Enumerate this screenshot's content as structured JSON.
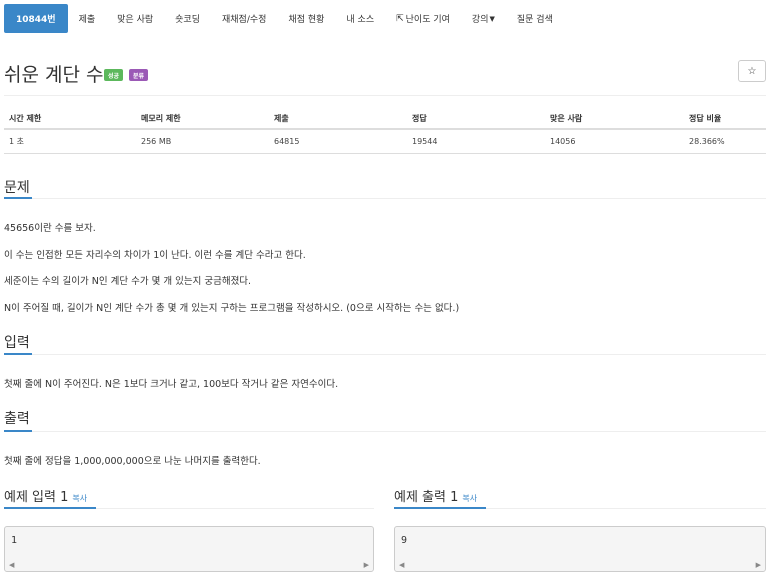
{
  "nav": {
    "tabs": [
      {
        "label": "10844번",
        "active": true
      },
      {
        "label": "제출"
      },
      {
        "label": "맞은 사람"
      },
      {
        "label": "숏코딩"
      },
      {
        "label": "재채점/수정"
      },
      {
        "label": "채점 현황"
      },
      {
        "label": "내 소스"
      },
      {
        "label": "난이도 기여",
        "icon": "external-link-icon"
      },
      {
        "label": "강의",
        "dropdown": true
      },
      {
        "label": "질문 검색"
      }
    ]
  },
  "problem": {
    "title": "쉬운 계단 수",
    "badges": [
      "성공",
      "분류"
    ],
    "star": "☆"
  },
  "info_table": {
    "headers": [
      "시간 제한",
      "메모리 제한",
      "제출",
      "정답",
      "맞은 사람",
      "정답 비율"
    ],
    "values": [
      "1 초",
      "256 MB",
      "64815",
      "19544",
      "14056",
      "28.366%"
    ]
  },
  "sections": {
    "description": {
      "heading": "문제",
      "paragraphs": [
        "45656이란 수를 보자.",
        "이 수는 인접한 모든 자리수의 차이가 1이 난다. 이런 수를 계단 수라고 한다.",
        "세준이는 수의 길이가 N인 계단 수가 몇 개 있는지 궁금해졌다.",
        "N이 주어질 때, 길이가 N인 계단 수가 총 몇 개 있는지 구하는 프로그램을 작성하시오. (0으로 시작하는 수는 없다.)"
      ]
    },
    "input": {
      "heading": "입력",
      "text": "첫째 줄에 N이 주어진다. N은 1보다 크거나 같고, 100보다 작거나 같은 자연수이다."
    },
    "output": {
      "heading": "출력",
      "text": "첫째 줄에 정답을 1,000,000,000으로 나눈 나머지를 출력한다."
    }
  },
  "samples": {
    "input": {
      "heading": "예제 입력 1",
      "copy": "복사",
      "value": "1"
    },
    "output": {
      "heading": "예제 출력 1",
      "copy": "복사",
      "value": "9"
    }
  },
  "colors": {
    "accent": "#3a87c8",
    "success": "#5cb85c",
    "category": "#9b59b6"
  }
}
